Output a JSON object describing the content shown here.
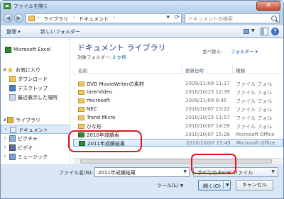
{
  "window": {
    "title": "ファイルを開く",
    "close_label": "✕"
  },
  "address": {
    "segments": [
      "ライブラリ",
      "ドキュメント"
    ],
    "search_placeholder": "ドキュメントの検索"
  },
  "commandbar": {
    "organize": "整理 ▾",
    "new_folder": "新しいフォルダー"
  },
  "navpane": {
    "items": [
      {
        "label": "Microsoft Excel",
        "icon": "excel-icon"
      },
      {
        "label": "お気に入り",
        "icon": "star-icon"
      },
      {
        "label": "ダウンロード",
        "icon": "folder-icon"
      },
      {
        "label": "デスクトップ",
        "icon": "desktop-icon"
      },
      {
        "label": "最近表示した場所",
        "icon": "recent-icon"
      },
      {
        "label": "ライブラリ",
        "icon": "library-icon"
      },
      {
        "label": "ドキュメント",
        "icon": "documents-icon"
      },
      {
        "label": "ピクチャ",
        "icon": "pictures-icon"
      },
      {
        "label": "ビデオ",
        "icon": "video-icon"
      },
      {
        "label": "ミュージック",
        "icon": "music-icon"
      }
    ]
  },
  "library": {
    "title": "ドキュメント ライブラリ",
    "subtitle_prefix": "対象フォルダー: ",
    "subtitle_link": "2 か所",
    "arrange_label": "並べ替え:",
    "arrange_value": "フォルダー ▾"
  },
  "columns": {
    "name": "名前",
    "date": "更新日時",
    "type": "種類"
  },
  "files": [
    {
      "name": "DVD MovieWriterの素材",
      "date": "2009/11/09 11:17",
      "type": "ファイル フォル",
      "kind": "folder",
      "selected": false
    },
    {
      "name": "InterVideo",
      "date": "2010/10/15 12:39",
      "type": "ファイル フォル",
      "kind": "folder",
      "selected": false
    },
    {
      "name": "microsoft",
      "date": "2009/11/09 9:45",
      "type": "ファイル フォル",
      "kind": "folder",
      "selected": false
    },
    {
      "name": "NEC",
      "date": "2010/10/07 15:22",
      "type": "ファイル フォル",
      "kind": "folder",
      "selected": false
    },
    {
      "name": "Trend Micro",
      "date": "2010/10/15 11:57",
      "type": "ファイル フォル",
      "kind": "folder",
      "selected": false
    },
    {
      "name": "ひな形",
      "date": "2010/10/07 14:29",
      "type": "ファイル フォル",
      "kind": "folder",
      "selected": false
    },
    {
      "name": "2010年成績表",
      "date": "2010/10/07 15:28",
      "type": "Microsoft Office",
      "kind": "excel",
      "selected": false
    },
    {
      "name": "2011年成績結果",
      "date": "2010/10/07 15:49",
      "type": "Microsoft Office",
      "kind": "excel",
      "selected": true
    }
  ],
  "bottom": {
    "filename_label": "ファイル名(N):",
    "filename_value": "2011年成績結果",
    "filter_value": "すべての Excel ファイル",
    "tools_label": "ツール(L)",
    "open_label": "開く(O)",
    "cancel_label": "キャンセル"
  },
  "colors": {
    "highlight_ring": "#e0161a",
    "accent": "#1e3287"
  }
}
